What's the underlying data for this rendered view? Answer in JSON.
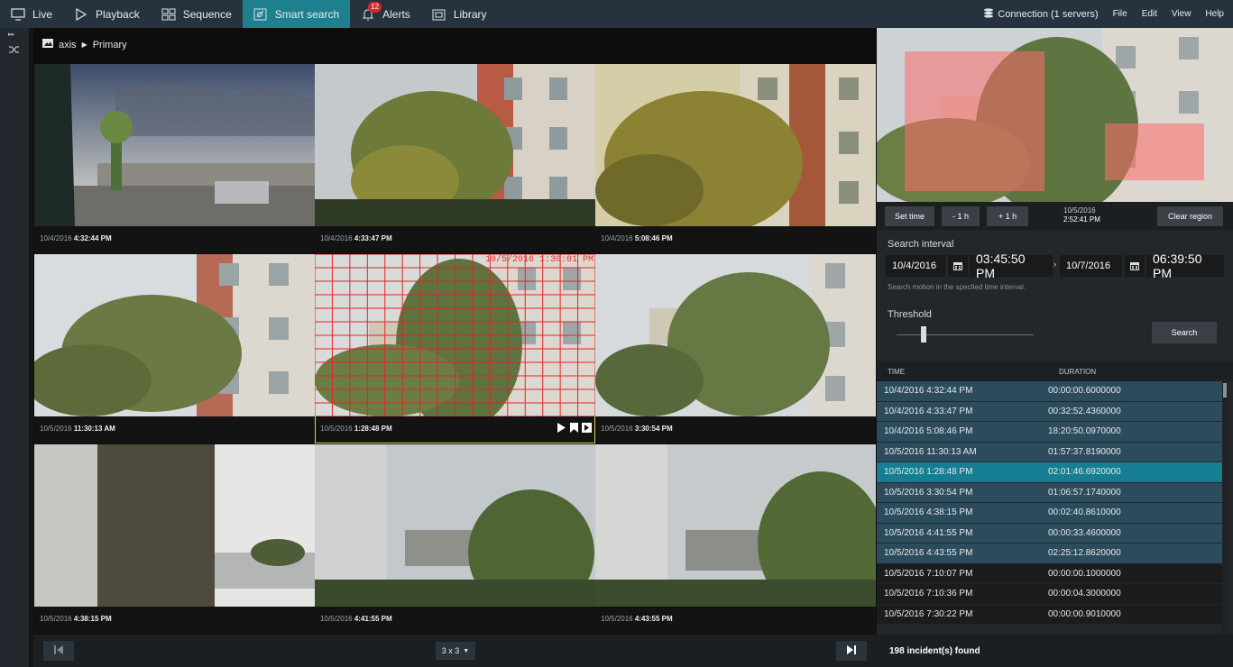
{
  "topbar": {
    "tabs": [
      {
        "label": "Live",
        "icon": "monitor-icon"
      },
      {
        "label": "Playback",
        "icon": "play-outline-icon"
      },
      {
        "label": "Sequence",
        "icon": "sequence-grid-icon"
      },
      {
        "label": "Smart search",
        "icon": "smart-search-icon"
      },
      {
        "label": "Alerts",
        "icon": "bell-icon",
        "badge": "12"
      },
      {
        "label": "Library",
        "icon": "library-icon"
      }
    ],
    "connection": "Connection (1 servers)",
    "menus": [
      "File",
      "Edit",
      "View",
      "Help"
    ]
  },
  "breadcrumb": {
    "camera": "axis",
    "stream": "Primary"
  },
  "cells": [
    {
      "date": "10/4/2016",
      "time": "4:32:44 PM"
    },
    {
      "date": "10/4/2016",
      "time": "4:33:47 PM"
    },
    {
      "date": "10/4/2016",
      "time": "5:08:46 PM"
    },
    {
      "date": "10/5/2016",
      "time": "11:30:13 AM"
    },
    {
      "date": "10/5/2016",
      "time": "1:28:48 PM",
      "overlay": "10/5/2016 1:30:01 PM"
    },
    {
      "date": "10/5/2016",
      "time": "3:30:54 PM"
    },
    {
      "date": "10/5/2016",
      "time": "4:38:15 PM"
    },
    {
      "date": "10/5/2016",
      "time": "4:41:55 PM"
    },
    {
      "date": "10/5/2016",
      "time": "4:43:55 PM"
    }
  ],
  "grid_layout": "3 x 3",
  "controls": {
    "set_time": "Set time",
    "minus_hour": "- 1 h",
    "plus_hour": "+ 1 h",
    "preview_date": "10/5/2016",
    "preview_time": "2:52:41 PM",
    "clear_region": "Clear region"
  },
  "search": {
    "interval_label": "Search interval",
    "from_date": "10/4/2016",
    "from_time": "03:45:50 PM",
    "to_date": "10/7/2016",
    "to_time": "06:39:50 PM",
    "help": "Search motion in the specfied time interval.",
    "threshold_label": "Threshold",
    "threshold_level": 0.2,
    "search_button": "Search"
  },
  "results": {
    "headers": [
      "TIME",
      "DURATION"
    ],
    "rows": [
      {
        "time": "10/4/2016 4:32:44 PM",
        "duration": "00:00:00.6000000",
        "state": "hl"
      },
      {
        "time": "10/4/2016 4:33:47 PM",
        "duration": "00:32:52.4360000",
        "state": "hl"
      },
      {
        "time": "10/4/2016 5:08:46 PM",
        "duration": "18:20:50.0970000",
        "state": "hl"
      },
      {
        "time": "10/5/2016 11:30:13 AM",
        "duration": "01:57:37.8190000",
        "state": "hl"
      },
      {
        "time": "10/5/2016 1:28:48 PM",
        "duration": "02:01:46.6920000",
        "state": "sel"
      },
      {
        "time": "10/5/2016 3:30:54 PM",
        "duration": "01:06:57.1740000",
        "state": "hl"
      },
      {
        "time": "10/5/2016 4:38:15 PM",
        "duration": "00:02:40.8610000",
        "state": "hl"
      },
      {
        "time": "10/5/2016 4:41:55 PM",
        "duration": "00:00:33.4600000",
        "state": "hl"
      },
      {
        "time": "10/5/2016 4:43:55 PM",
        "duration": "02:25:12.8620000",
        "state": "hl"
      },
      {
        "time": "10/5/2016 7:10:07 PM",
        "duration": "00:00:00.1000000",
        "state": "plain"
      },
      {
        "time": "10/5/2016 7:10:36 PM",
        "duration": "00:00:04.3000000",
        "state": "plain"
      },
      {
        "time": "10/5/2016 7:30:22 PM",
        "duration": "00:00:00.9010000",
        "state": "plain"
      }
    ],
    "count_text": "198 incident(s) found"
  },
  "colors": {
    "accent": "#1e7f8e",
    "selected_row": "#167e92",
    "region": "#ff6b6b"
  }
}
